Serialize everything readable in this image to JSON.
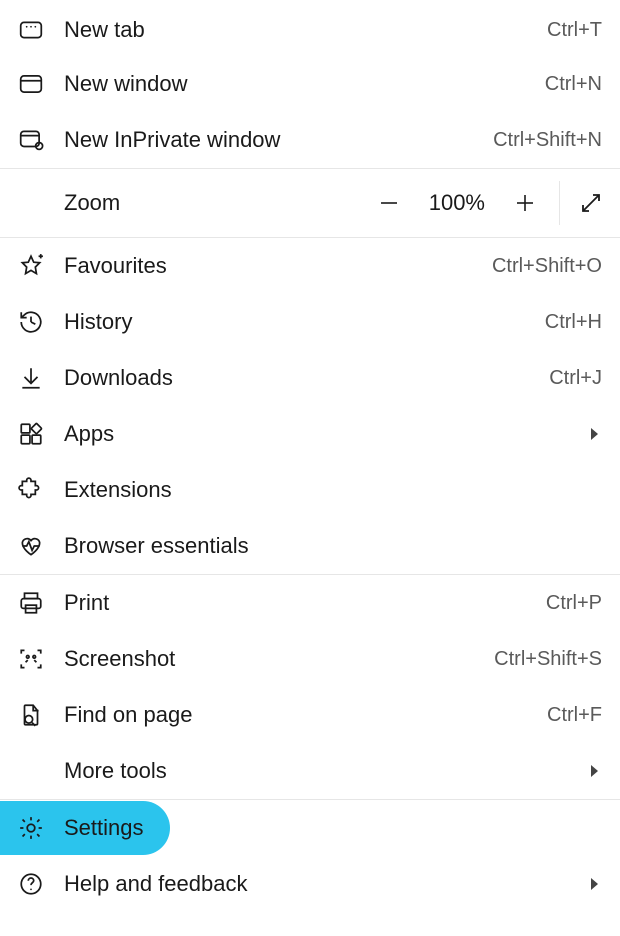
{
  "new_tab": {
    "label": "New tab",
    "shortcut": "Ctrl+T"
  },
  "new_window": {
    "label": "New window",
    "shortcut": "Ctrl+N"
  },
  "new_inprivate": {
    "label": "New InPrivate window",
    "shortcut": "Ctrl+Shift+N"
  },
  "zoom": {
    "label": "Zoom",
    "value": "100%"
  },
  "favourites": {
    "label": "Favourites",
    "shortcut": "Ctrl+Shift+O"
  },
  "history": {
    "label": "History",
    "shortcut": "Ctrl+H"
  },
  "downloads": {
    "label": "Downloads",
    "shortcut": "Ctrl+J"
  },
  "apps": {
    "label": "Apps"
  },
  "extensions": {
    "label": "Extensions"
  },
  "browser_essentials": {
    "label": "Browser essentials"
  },
  "print": {
    "label": "Print",
    "shortcut": "Ctrl+P"
  },
  "screenshot": {
    "label": "Screenshot",
    "shortcut": "Ctrl+Shift+S"
  },
  "find_on_page": {
    "label": "Find on page",
    "shortcut": "Ctrl+F"
  },
  "more_tools": {
    "label": "More tools"
  },
  "settings": {
    "label": "Settings"
  },
  "help": {
    "label": "Help and feedback"
  }
}
